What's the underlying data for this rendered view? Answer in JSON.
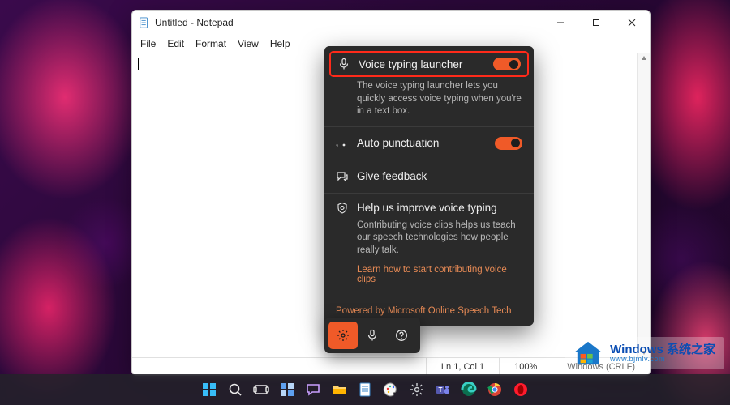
{
  "notepad": {
    "title": "Untitled - Notepad",
    "menus": [
      "File",
      "Edit",
      "Format",
      "View",
      "Help"
    ],
    "editor_text": "",
    "status": {
      "position": "Ln 1, Col 1",
      "zoom": "100%",
      "line_ending": "Windows (CRLF)"
    }
  },
  "voice_typing": {
    "launcher": {
      "title": "Voice typing launcher",
      "desc": "The voice typing launcher lets you quickly access voice typing when you're in a text box.",
      "on": true
    },
    "auto_punctuation": {
      "title": "Auto punctuation",
      "on": true
    },
    "feedback": {
      "title": "Give feedback"
    },
    "improve": {
      "title": "Help us improve voice typing",
      "body": "Contributing voice clips helps us teach our speech technologies how people really talk.",
      "link": "Learn how to start contributing voice clips"
    },
    "powered": "Powered by Microsoft Online Speech Tech",
    "toolbar": {
      "settings": "Settings",
      "mic": "Microphone",
      "help": "Help"
    },
    "accent": "#f05a28"
  },
  "taskbar": {
    "items": [
      "start",
      "search",
      "task-view",
      "widgets",
      "chat",
      "file-explorer",
      "notepad",
      "paint",
      "settings",
      "teams",
      "edge",
      "chrome",
      "opera"
    ]
  },
  "watermark": {
    "brand": "Windows 系统之家",
    "url": "www.bjmlv.com"
  }
}
